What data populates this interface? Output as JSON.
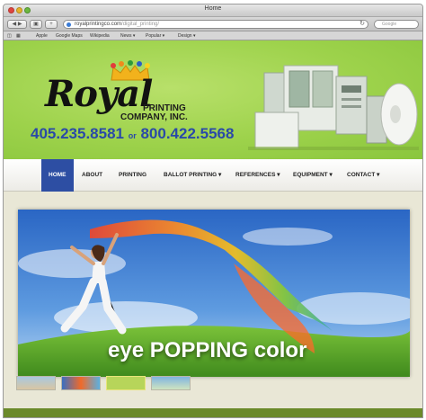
{
  "browser": {
    "window_title": "Home",
    "url_domain": "royalprintingco.com",
    "url_path": "/digital_printing/",
    "search_placeholder": "Google",
    "bookmarks": [
      "Apple",
      "Google Maps",
      "Wikipedia",
      "News ▾",
      "Popular ▾",
      "Design ▾"
    ]
  },
  "header": {
    "logo_word": "Royal",
    "logo_line1": "PRINTING",
    "logo_line2": "COMPANY, INC.",
    "phone_1": "405.235.8581",
    "phone_or": "or",
    "phone_2": "800.422.5568"
  },
  "nav": {
    "items": [
      {
        "label": "HOME"
      },
      {
        "label": "ABOUT"
      },
      {
        "label": "PRINTING"
      },
      {
        "label": "BALLOT PRINTING ▾"
      },
      {
        "label": "REFERENCES ▾"
      },
      {
        "label": "EQUIPMENT ▾"
      },
      {
        "label": "CONTACT ▾"
      }
    ]
  },
  "banner": {
    "caption": "eye POPPING color"
  },
  "colors": {
    "header_green": "#9dd24b",
    "nav_active": "#2d4ea3",
    "phone_blue": "#2a49a8"
  }
}
